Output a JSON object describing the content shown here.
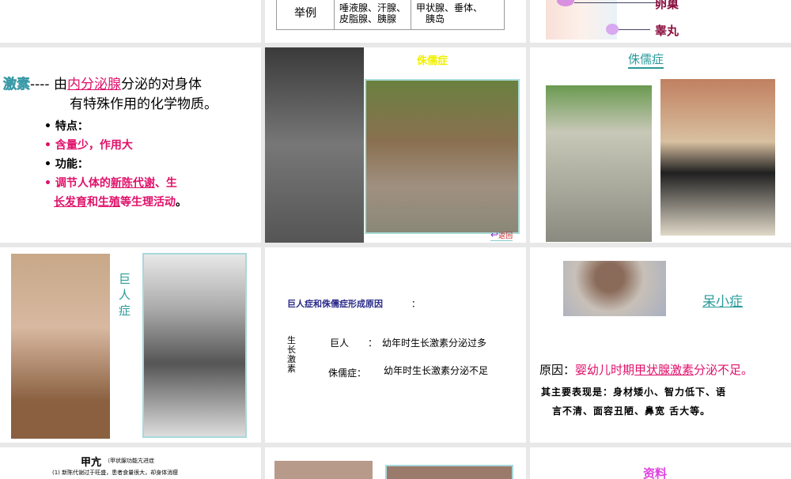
{
  "slides": [
    {
      "table": {
        "label": "举例",
        "exocrine": [
          "唾液腺、汗腺、",
          "皮脂腺、胰腺"
        ],
        "endocrine": [
          "甲状腺、垂体、",
          "胰岛"
        ]
      }
    },
    {
      "labels": {
        "ovary": "卵巢",
        "testis": "睾丸"
      }
    },
    {
      "title_word": "激素",
      "dash": "----",
      "def_pre": "由",
      "def_hl": "内分泌腺",
      "def_post": "分泌的对身体",
      "def_line2": "有特殊作用的化学物质。",
      "b1": "特点：",
      "b2": "含量少，作用大",
      "b3": "功能：",
      "b4a": "调节人体的",
      "b4b": "新陈代谢",
      "b4c": "、生",
      "b4d": "长发育",
      "b4e": "和",
      "b4f": "生殖",
      "b4g": "等生理活动",
      "b4h": "。"
    },
    {
      "title": "侏儒症",
      "back": "返回"
    },
    {
      "title": "侏儒症"
    },
    {
      "title": "巨人症"
    },
    {
      "heading": "巨人症和侏儒症形成原因",
      "colon": "：",
      "side": "生长激素",
      "r1_label": "巨人",
      "r1_colon": "：",
      "r1_text": "幼年时生长激素分泌过多",
      "r2_label": "侏儒症：",
      "r2_text": "幼年时生长激素分泌不足"
    },
    {
      "title": "呆小症",
      "cause_label": "原因：",
      "cause_a": "婴幼儿时期",
      "cause_b": "甲状腺激素",
      "cause_c": "分泌不足。",
      "symptoms": [
        "其主要表现是：身材矮小、智力低下、语",
        "言不清、面容丑陋、鼻宽 舌大等。"
      ]
    },
    {
      "title": "甲亢",
      "subtitle": "（甲状腺功能亢进症",
      "line1": "(1) 新陈代谢过于旺盛，患者食量很大，却身体消瘦"
    },
    {},
    {
      "title": "资料"
    }
  ],
  "colors": {
    "pink": "#e0106a",
    "teal": "#2a9a9a",
    "navy": "#2a2a8a",
    "yellow": "#f0f000"
  }
}
